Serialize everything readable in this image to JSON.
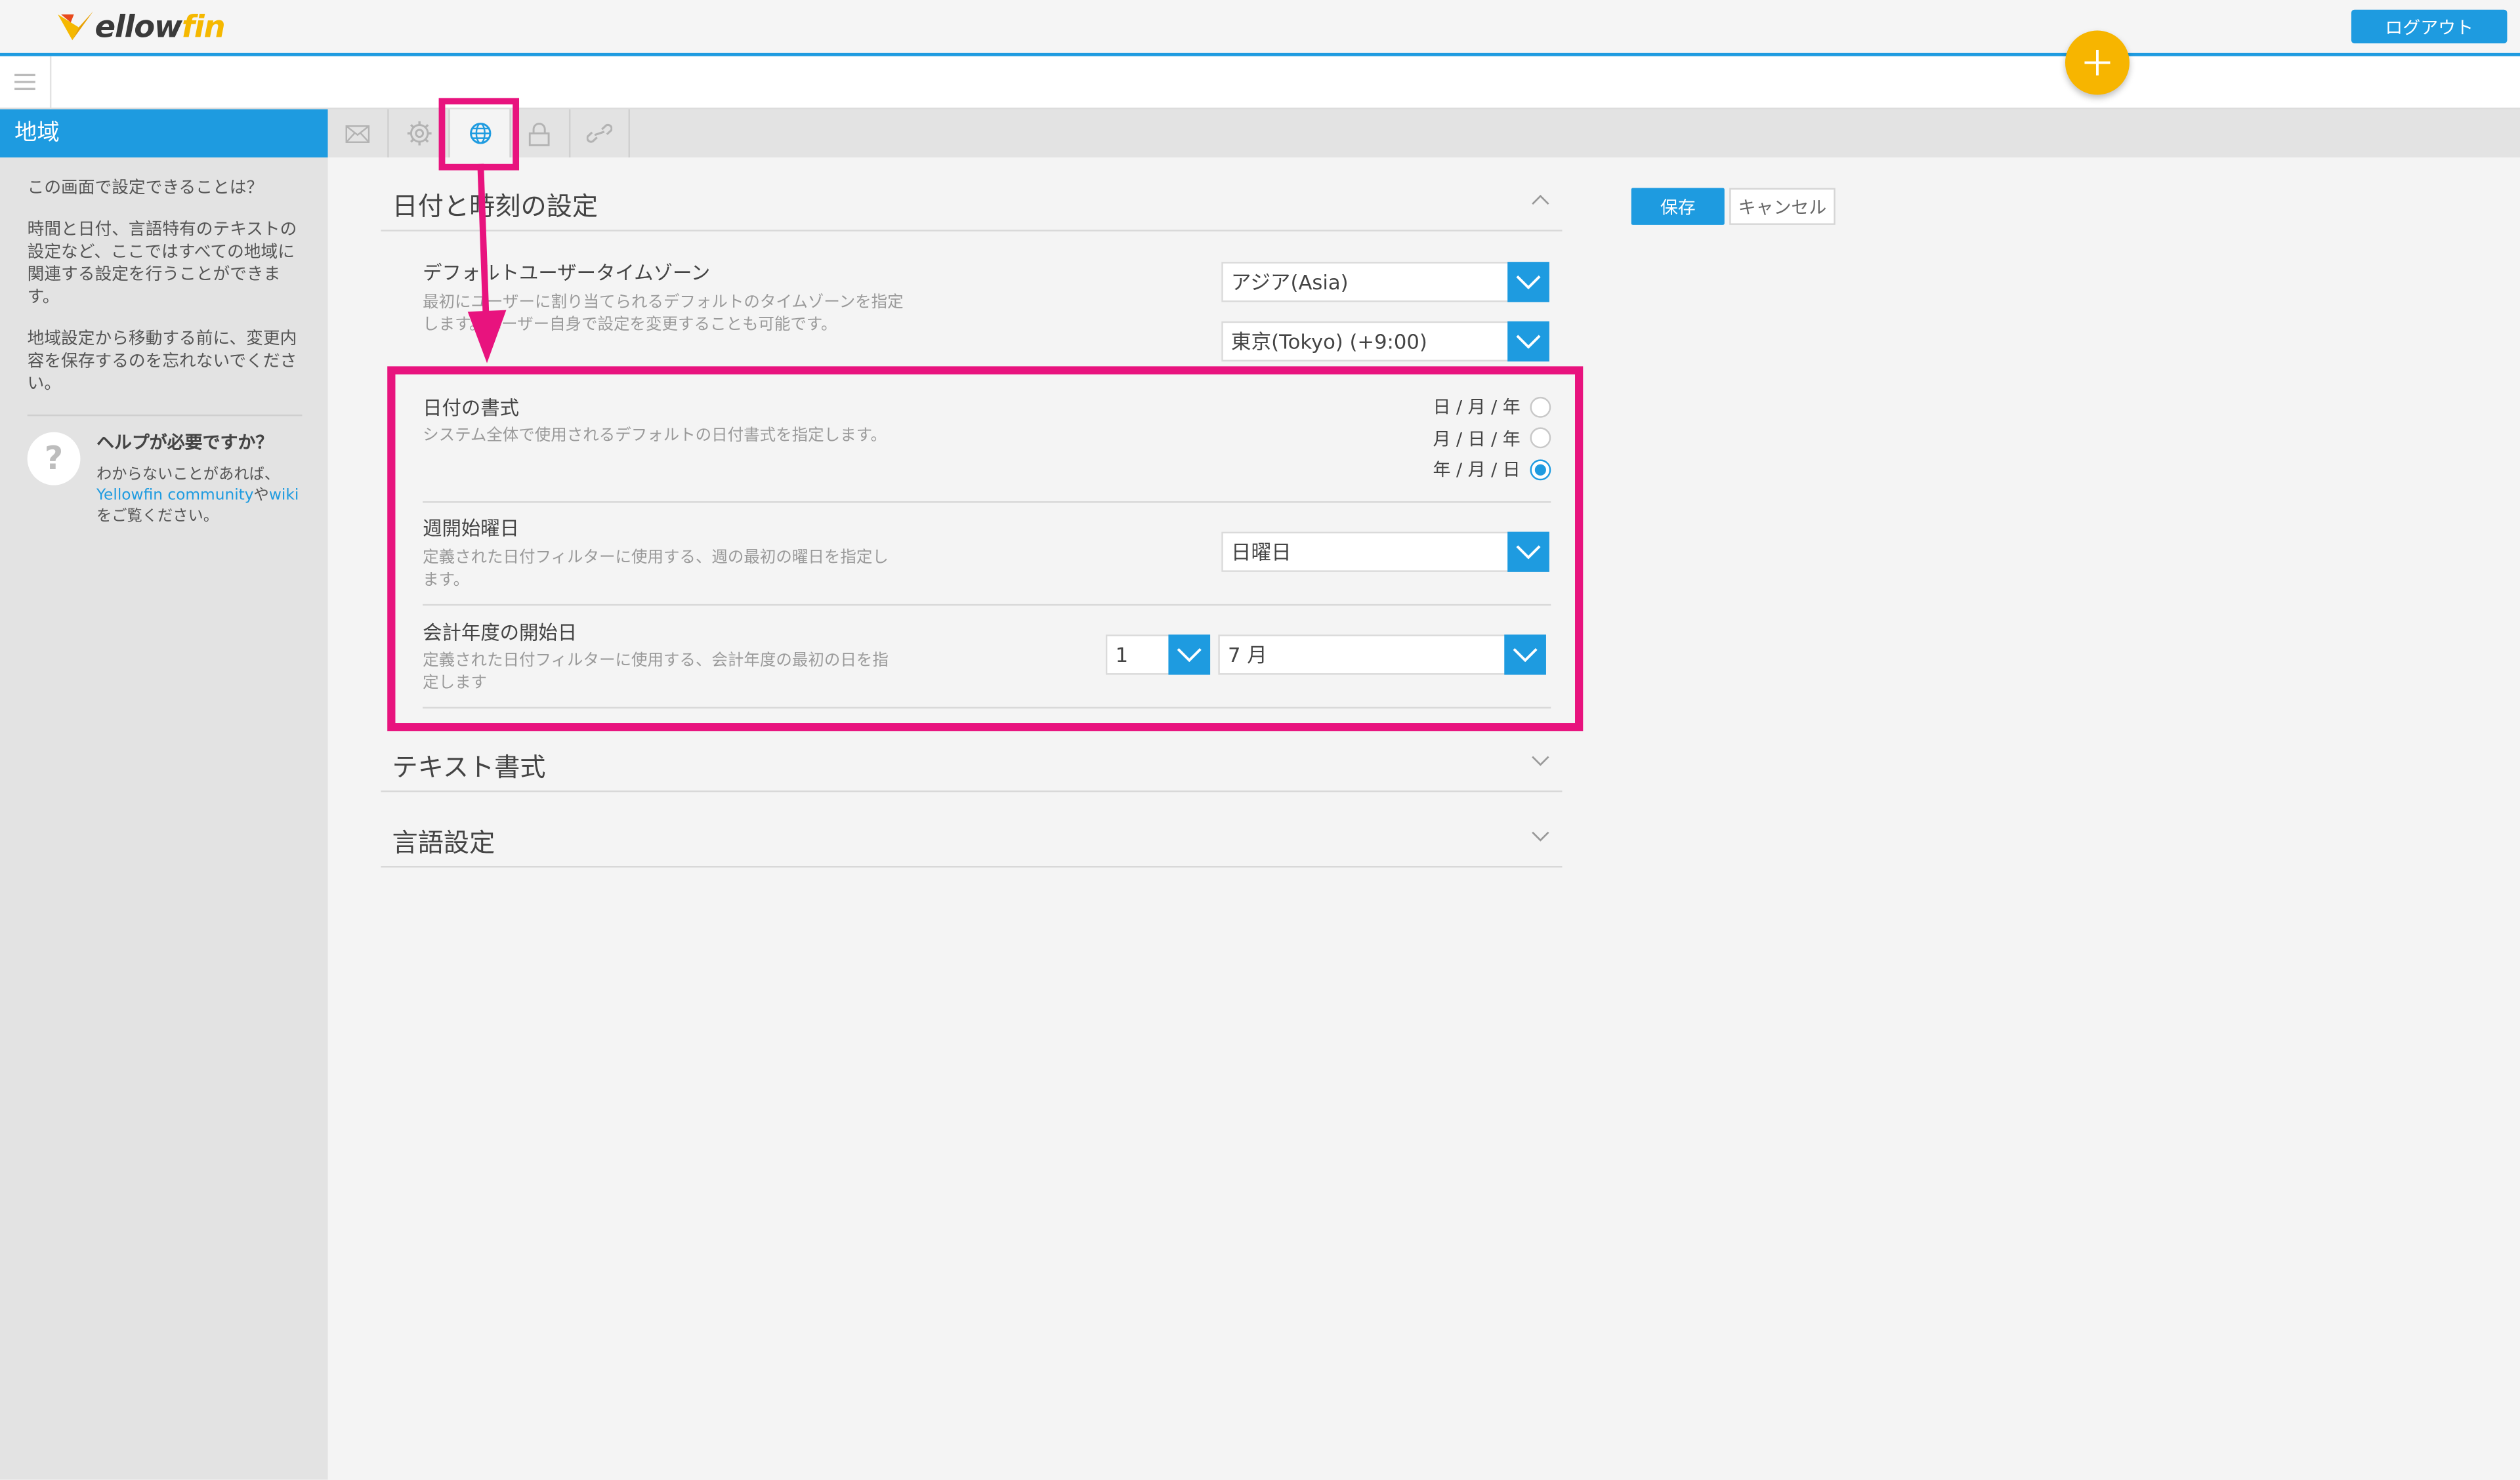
{
  "app": {
    "logo_text": "Yellowfin",
    "logout_label": "ログアウト"
  },
  "sidebar": {
    "title": "地域",
    "intro_question": "この画面で設定できることは？",
    "intro_text": "時間と日付、言語特有のテキストの設定など、ここではすべての地域に関連する設定を行うことができます。",
    "reminder_text": "地域設定から移動する前に、変更内容を保存するのを忘れないでください。",
    "help_title": "ヘルプが必要ですか？",
    "help_text_before": "わからないことがあれば、",
    "help_link_community": "Yellowfin community",
    "help_text_mid": "や",
    "help_link_wiki": "wiki",
    "help_text_after": "をご覧ください。"
  },
  "tabs": [
    {
      "icon": "mail-icon"
    },
    {
      "icon": "gear-icon"
    },
    {
      "icon": "globe-icon",
      "active": true
    },
    {
      "icon": "lock-icon"
    },
    {
      "icon": "link-icon"
    }
  ],
  "actions": {
    "save_label": "保存",
    "cancel_label": "キャンセル"
  },
  "datetime": {
    "section_title": "日付と時刻の設定",
    "timezone": {
      "label": "デフォルトユーザータイムゾーン",
      "desc_line1": "最初にユーザーに割り当てられるデフォルトのタイムゾーンを指定",
      "desc_line2": "します。ユーザー自身で設定を変更することも可能です。",
      "region_value": "アジア(Asia)",
      "city_value": "東京(Tokyo) (+9:00)"
    },
    "date_format": {
      "label": "日付の書式",
      "desc": "システム全体で使用されるデフォルトの日付書式を指定します。",
      "options": [
        "日 / 月 / 年",
        "月 / 日 / 年",
        "年 / 月 / 日"
      ],
      "selected_index": 2
    },
    "week_start": {
      "label": "週開始曜日",
      "desc_line1": "定義された日付フィルターに使用する、週の最初の曜日を指定し",
      "desc_line2": "ます。",
      "value": "日曜日"
    },
    "fiscal_start": {
      "label": "会計年度の開始日",
      "desc_line1": "定義された日付フィルターに使用する、会計年度の最初の日を指",
      "desc_line2": "定します",
      "day_value": "1",
      "month_value": "7 月"
    }
  },
  "text_format": {
    "section_title": "テキスト書式"
  },
  "language": {
    "section_title": "言語設定"
  },
  "colors": {
    "accent": "#1e9be0",
    "highlight": "#e8137e",
    "fab": "#f7b500"
  }
}
